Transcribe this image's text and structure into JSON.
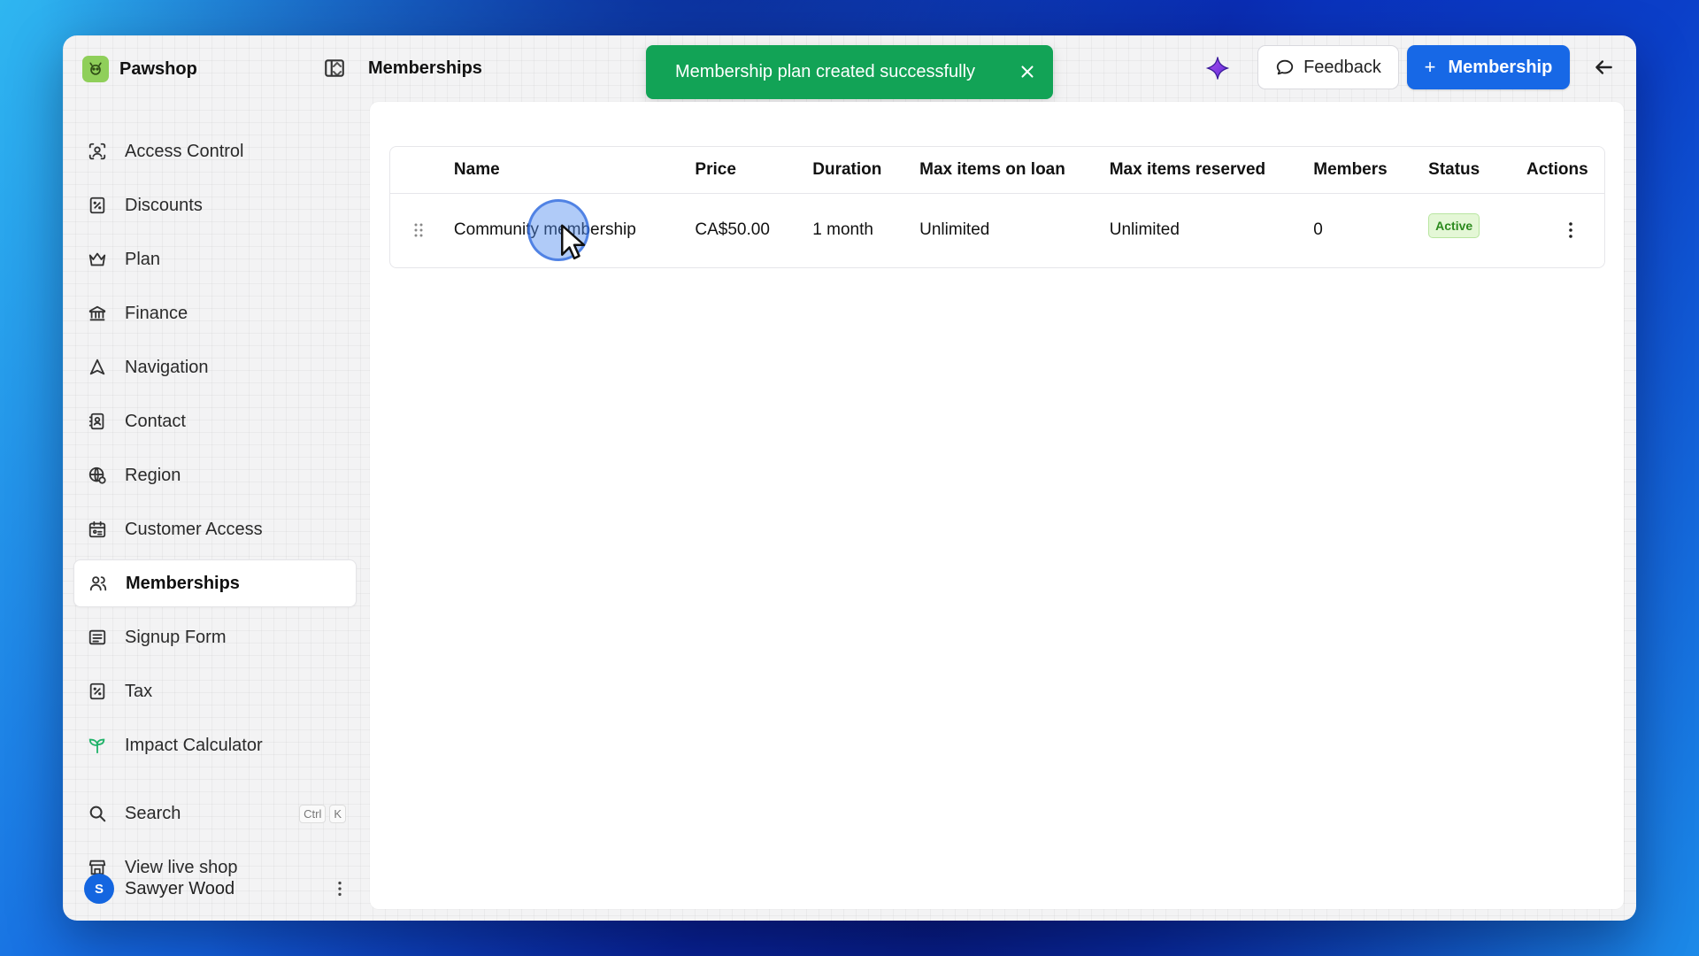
{
  "brand": {
    "name": "Pawshop"
  },
  "header": {
    "title": "Memberships",
    "feedback_label": "Feedback",
    "primary_label": "Membership",
    "primary_plus": "+"
  },
  "toast": {
    "message": "Membership plan created successfully"
  },
  "sidebar": {
    "items": [
      {
        "label": "Access Control",
        "icon": "scan-face-icon"
      },
      {
        "label": "Discounts",
        "icon": "discount-icon"
      },
      {
        "label": "Plan",
        "icon": "crown-icon"
      },
      {
        "label": "Finance",
        "icon": "bank-icon"
      },
      {
        "label": "Navigation",
        "icon": "navigation-icon"
      },
      {
        "label": "Contact",
        "icon": "contact-book-icon"
      },
      {
        "label": "Region",
        "icon": "globe-settings-icon"
      },
      {
        "label": "Customer Access",
        "icon": "calendar-user-icon"
      },
      {
        "label": "Memberships",
        "icon": "users-icon",
        "active": true
      },
      {
        "label": "Signup Form",
        "icon": "form-icon"
      },
      {
        "label": "Tax",
        "icon": "tax-icon"
      },
      {
        "label": "Impact Calculator",
        "icon": "sprout-icon",
        "color": "#22b36a"
      }
    ],
    "search": {
      "label": "Search",
      "kbd1": "Ctrl",
      "kbd2": "K"
    },
    "live_shop": {
      "label": "View live shop"
    },
    "user": {
      "name": "Sawyer Wood",
      "initial": "S"
    }
  },
  "table": {
    "headers": [
      "Name",
      "Price",
      "Duration",
      "Max items on loan",
      "Max items reserved",
      "Members",
      "Status",
      "Actions"
    ],
    "rows": [
      {
        "name": "Community membership",
        "price": "CA$50.00",
        "duration": "1 month",
        "max_loan": "Unlimited",
        "max_reserved": "Unlimited",
        "members": "0",
        "status": "Active"
      }
    ]
  },
  "colors": {
    "primary": "#1768e6",
    "toast": "#12a356",
    "active_badge": "#e4f7d6"
  }
}
